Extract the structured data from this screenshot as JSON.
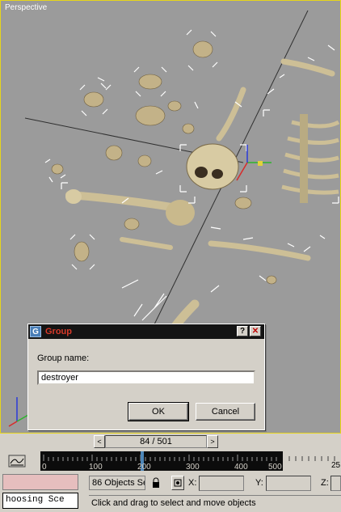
{
  "viewport": {
    "label": "Perspective"
  },
  "dialog": {
    "title": "Group",
    "help": "?",
    "close": "✕",
    "group_name_label": "Group name:",
    "group_name_value": "destroyer",
    "ok_label": "OK",
    "cancel_label": "Cancel"
  },
  "timeslider": {
    "prev": "<",
    "frame": "84 / 501",
    "next": ">"
  },
  "trackbar": {
    "ticks": [
      "0",
      "100",
      "200",
      "300",
      "400",
      "500"
    ],
    "end_tick": "25"
  },
  "status": {
    "selection": "86 Objects Se",
    "x_label": "X:",
    "y_label": "Y:",
    "z_label": "Z:",
    "script_text": "hoosing Sce",
    "prompt": "Click and drag to select and move objects"
  },
  "colors": {
    "viewport_bg": "#9b9b9b",
    "active_border": "#e7d51a",
    "bone": "#cdbf96",
    "selection": "#ffffff"
  }
}
